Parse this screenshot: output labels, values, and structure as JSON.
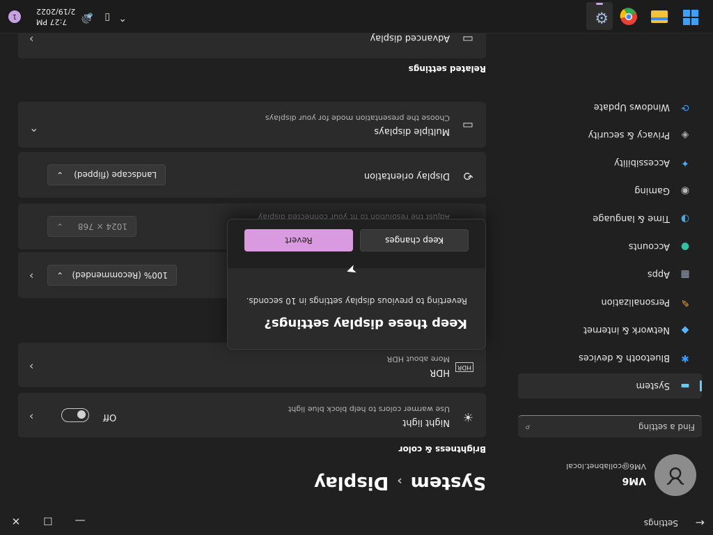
{
  "app": {
    "title": "Settings",
    "back_icon": "back-arrow-icon",
    "minimize": "—",
    "maximize": "☐",
    "close": "✕"
  },
  "user": {
    "name": "VM6",
    "email": "VM6@collabnet.local",
    "avatar_glyph": "♉"
  },
  "search": {
    "placeholder": "Find a setting",
    "icon": "⌕"
  },
  "nav": [
    {
      "label": "System",
      "icon": "▬",
      "color": "#60cdff"
    },
    {
      "label": "Bluetooth & devices",
      "icon": "✱",
      "color": "#3b9cff"
    },
    {
      "label": "Network & internet",
      "icon": "◆",
      "color": "#5bb4ff"
    },
    {
      "label": "Personalization",
      "icon": "✎",
      "color": "#e8a040"
    },
    {
      "label": "Apps",
      "icon": "▦",
      "color": "#9aa5b8"
    },
    {
      "label": "Accounts",
      "icon": "●",
      "color": "#32c0a0"
    },
    {
      "label": "Time & language",
      "icon": "◑",
      "color": "#4aa8e0"
    },
    {
      "label": "Gaming",
      "icon": "◉",
      "color": "#bbbbbb"
    },
    {
      "label": "Accessibility",
      "icon": "✦",
      "color": "#4ab0ff"
    },
    {
      "label": "Privacy & security",
      "icon": "◈",
      "color": "#aaaaaa"
    },
    {
      "label": "Windows Update",
      "icon": "⟳",
      "color": "#3b9cff"
    }
  ],
  "breadcrumb": {
    "parent": "System",
    "sep": "›",
    "current": "Display"
  },
  "brightness": {
    "section": "Brightness & color",
    "night": {
      "title": "Night light",
      "subtitle": "Use warmer colors to help block blue light",
      "state": "Off",
      "icon": "☀"
    },
    "hdr": {
      "title": "HDR",
      "subtitle": "More about HDR",
      "icon": "HDR"
    }
  },
  "scale": {
    "value": "100% (Recommended)"
  },
  "resolution": {
    "subtitle": "Adjust the resolution to fit your connected display",
    "value": "1024 × 768"
  },
  "orientation": {
    "title": "Display orientation",
    "value": "Landscape (flipped)",
    "icon": "⟲"
  },
  "multiple": {
    "title": "Multiple displays",
    "subtitle": "Choose the presentation mode for your displays",
    "icon": "▭"
  },
  "related": {
    "section": "Related settings",
    "advanced": {
      "title": "Advanced display",
      "icon": "▭"
    }
  },
  "dialog": {
    "title": "Keep these display settings?",
    "message": "Reverting to previous display settings in 10 seconds.",
    "keep": "Keep changes",
    "revert": "Revert"
  },
  "taskbar": {
    "time": "7:27 PM",
    "date": "2/19/2022",
    "notif": "1",
    "chevron": "⌃",
    "battery": "▯",
    "speaker": "🔊"
  },
  "colors": {
    "accent": "#60cdff",
    "revert": "#d99ae0"
  }
}
